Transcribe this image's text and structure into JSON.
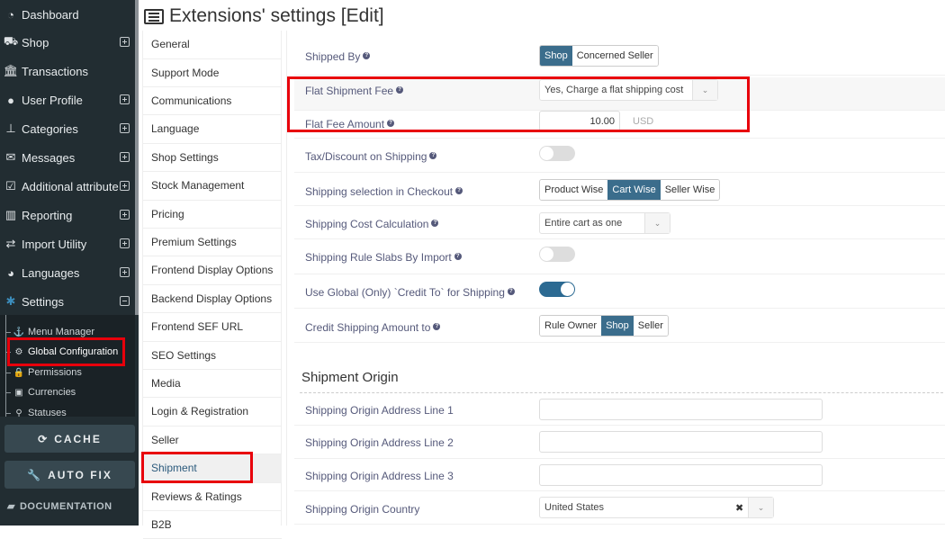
{
  "sidebar": {
    "items": [
      {
        "label": "Dashboard",
        "icon": "dashboard-icon",
        "expand": ""
      },
      {
        "label": "Shop",
        "icon": "cart-icon",
        "expand": "plus"
      },
      {
        "label": "Transactions",
        "icon": "bank-icon",
        "expand": ""
      },
      {
        "label": "User Profile",
        "icon": "user-icon",
        "expand": "plus"
      },
      {
        "label": "Categories",
        "icon": "sitemap-icon",
        "expand": "plus"
      },
      {
        "label": "Messages",
        "icon": "envelope-icon",
        "expand": "plus"
      },
      {
        "label": "Additional attribute",
        "icon": "checkbox-icon",
        "expand": "plus"
      },
      {
        "label": "Reporting",
        "icon": "bar-chart-icon",
        "expand": "plus"
      },
      {
        "label": "Import Utility",
        "icon": "exchange-icon",
        "expand": "plus"
      },
      {
        "label": "Languages",
        "icon": "globe-icon",
        "expand": "plus"
      },
      {
        "label": "Settings",
        "icon": "gear-icon",
        "expand": "minus"
      }
    ],
    "sub_items": [
      {
        "label": "Menu Manager",
        "icon": "anchor-icon"
      },
      {
        "label": "Global Configuration",
        "icon": "gears-icon"
      },
      {
        "label": "Permissions",
        "icon": "lock-icon"
      },
      {
        "label": "Currencies",
        "icon": "money-icon"
      },
      {
        "label": "Statuses",
        "icon": "key-icon"
      }
    ],
    "cache_label": "CACHE",
    "autofix_label": "AUTO FIX",
    "documentation_label": "DOCUMENTATION"
  },
  "header": {
    "title": "Extensions' settings [Edit]"
  },
  "tabs": [
    "General",
    "Support Mode",
    "Communications",
    "Language",
    "Shop Settings",
    "Stock Management",
    "Pricing",
    "Premium Settings",
    "Frontend Display Options",
    "Backend Display Options",
    "Frontend SEF URL",
    "SEO Settings",
    "Media",
    "Login & Registration",
    "Seller",
    "Shipment",
    "Reviews & Ratings",
    "B2B"
  ],
  "active_tab": "Shipment",
  "form": {
    "shipped_by": {
      "label": "Shipped By",
      "options": [
        "Shop",
        "Concerned Seller"
      ],
      "selected": "Shop"
    },
    "flat_fee": {
      "label": "Flat Shipment Fee",
      "value": "Yes, Charge a flat shipping cost"
    },
    "flat_amount": {
      "label": "Flat Fee Amount",
      "value": "10.00",
      "currency": "USD"
    },
    "tax_discount": {
      "label": "Tax/Discount on Shipping",
      "on": false
    },
    "selection": {
      "label": "Shipping selection in Checkout",
      "options": [
        "Product Wise",
        "Cart Wise",
        "Seller Wise"
      ],
      "selected": "Cart Wise"
    },
    "cost_calc": {
      "label": "Shipping Cost Calculation",
      "value": "Entire cart as one"
    },
    "rule_slabs": {
      "label": "Shipping Rule Slabs By Import",
      "on": false
    },
    "use_global": {
      "label": "Use Global (Only) `Credit To` for Shipping",
      "on": true
    },
    "credit_to": {
      "label": "Credit Shipping Amount to",
      "options": [
        "Rule Owner",
        "Shop",
        "Seller"
      ],
      "selected": "Shop"
    }
  },
  "origin": {
    "title": "Shipment Origin",
    "line1": {
      "label": "Shipping Origin Address Line 1",
      "value": ""
    },
    "line2": {
      "label": "Shipping Origin Address Line 2",
      "value": ""
    },
    "line3": {
      "label": "Shipping Origin Address Line 3",
      "value": ""
    },
    "country": {
      "label": "Shipping Origin Country",
      "value": "United States"
    }
  },
  "colors": {
    "accent": "#3b6d8c",
    "highlight": "#e8000b",
    "sidebar_bg": "#222d32"
  }
}
